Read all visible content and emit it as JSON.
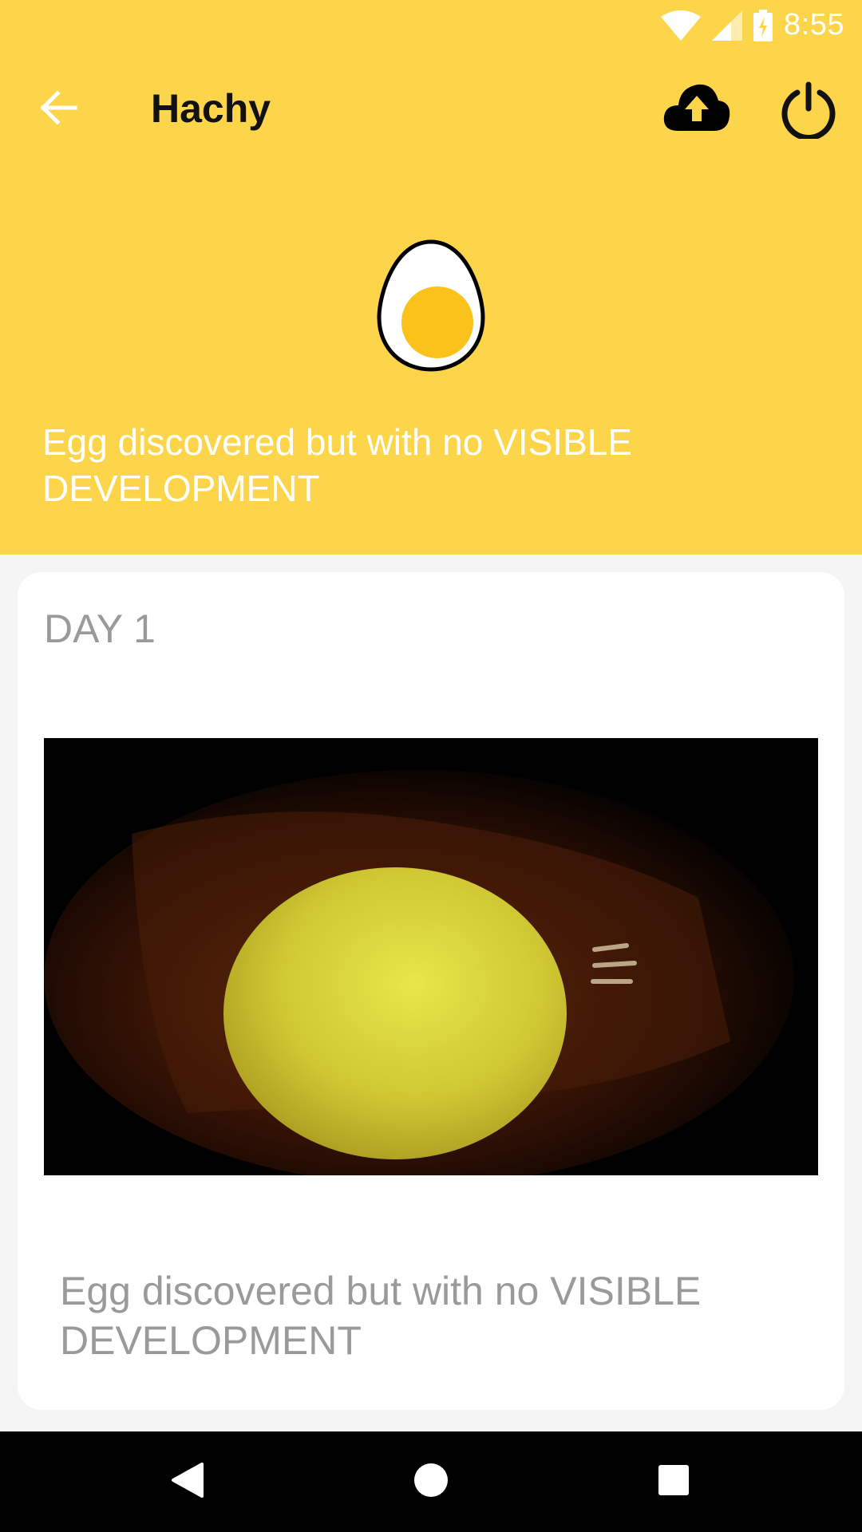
{
  "status_bar": {
    "time": "8:55",
    "icons": [
      "wifi-icon",
      "signal-icon",
      "battery-charging-icon"
    ]
  },
  "app_bar": {
    "title": "Hachy",
    "back_icon": "arrow-back-icon",
    "upload_icon": "cloud-upload-icon",
    "power_icon": "power-icon"
  },
  "header": {
    "egg_icon": "egg-icon",
    "status_text": "Egg discovered but with no VISIBLE DEVELOPMENT"
  },
  "card": {
    "day_label": "DAY 1",
    "photo": "candled-egg-photo",
    "description": "Egg discovered but with no VISIBLE DEVELOPMENT"
  },
  "nav_bar": {
    "buttons": [
      "back-triangle-icon",
      "home-circle-icon",
      "recents-square-icon"
    ]
  },
  "colors": {
    "header_bg": "#FDD54A",
    "yolk": "#FBC21B",
    "card_text": "#9a9a9a"
  }
}
